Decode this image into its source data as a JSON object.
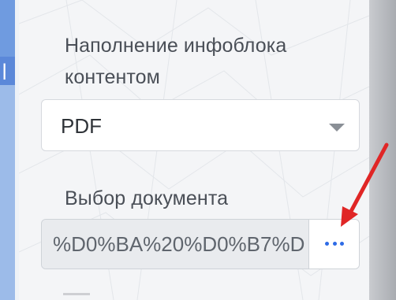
{
  "form": {
    "content_label": "Наполнение инфоблока контентом",
    "content_select": {
      "selected": "PDF"
    },
    "document_label": "Выбор документа",
    "document_field": {
      "value": "%D0%BA%20%D0%B7%D",
      "browse_button_icon": "ellipsis-icon"
    }
  },
  "annotation": {
    "arrow_color": "#e02626"
  },
  "colors": {
    "accent": "#2e6be6",
    "label_text": "#4a4f57",
    "panel_bg": "#f4f5f7"
  }
}
